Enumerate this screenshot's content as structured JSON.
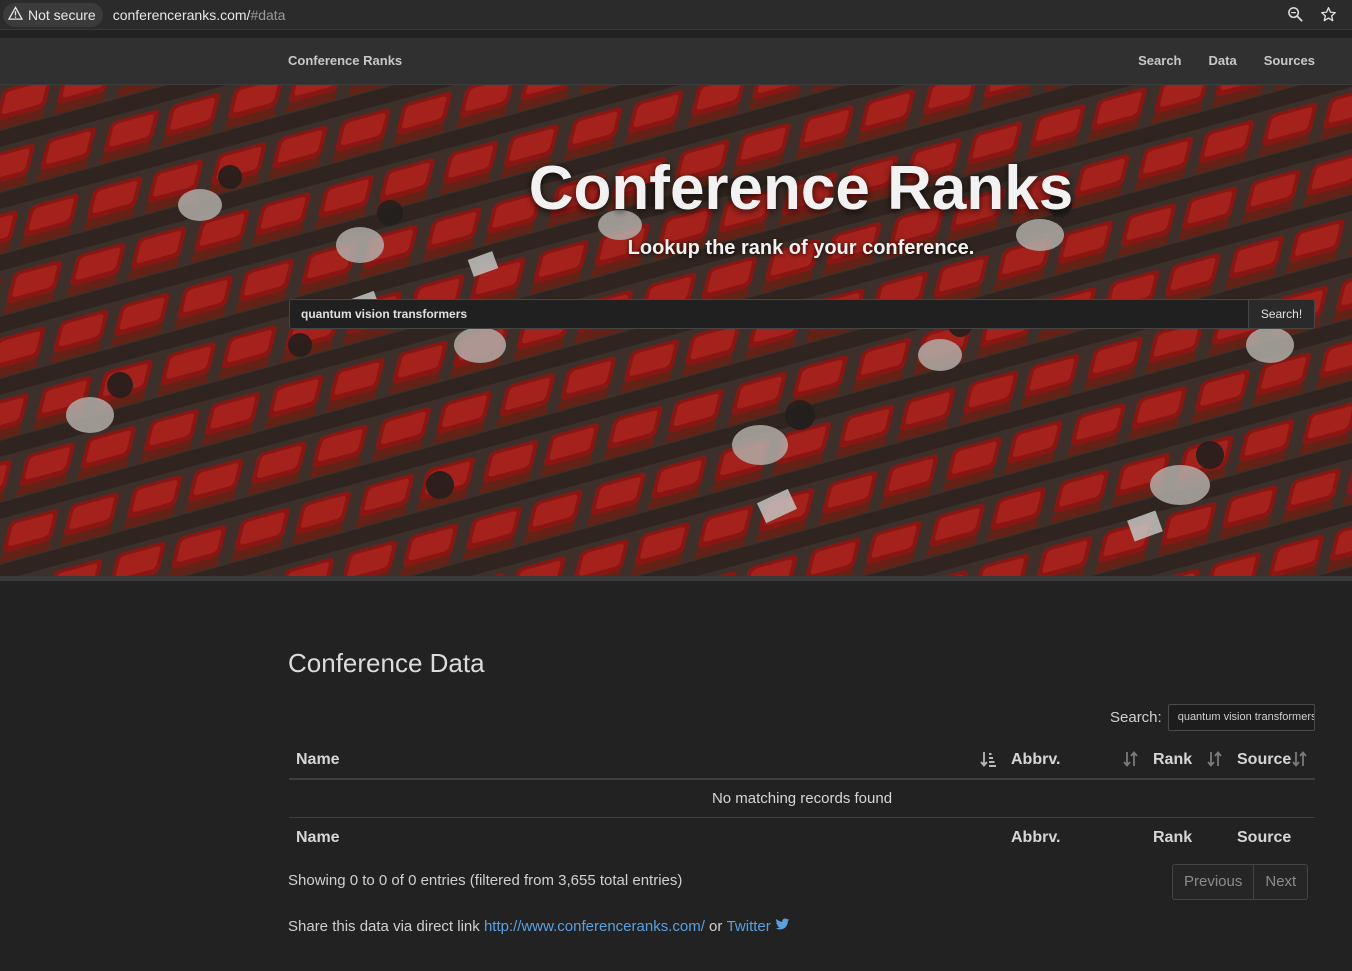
{
  "browser": {
    "security_label": "Not secure",
    "url_host": "conferenceranks.com/",
    "url_path": "#data"
  },
  "nav": {
    "brand": "Conference Ranks",
    "links": [
      "Search",
      "Data",
      "Sources"
    ]
  },
  "hero": {
    "title": "Conference Ranks",
    "subtitle": "Lookup the rank of your conference.",
    "search_value": "quantum vision transformers",
    "search_button": "Search!"
  },
  "data_section": {
    "title": "Conference Data",
    "search_label": "Search:",
    "search_value": "quantum vision transformers",
    "columns": [
      "Name",
      "Abbrv.",
      "Rank",
      "Source"
    ],
    "empty_message": "No matching records found",
    "info": "Showing 0 to 0 of 0 entries (filtered from 3,655 total entries)",
    "pager": {
      "previous": "Previous",
      "next": "Next"
    },
    "share": {
      "prefix": "Share this data via direct link ",
      "link": "http://www.conferenceranks.com/",
      "middle": " or ",
      "twitter": "Twitter"
    }
  },
  "colors": {
    "background": "#222222",
    "link": "#5ba0e0",
    "seat_red": "#c4221c"
  }
}
